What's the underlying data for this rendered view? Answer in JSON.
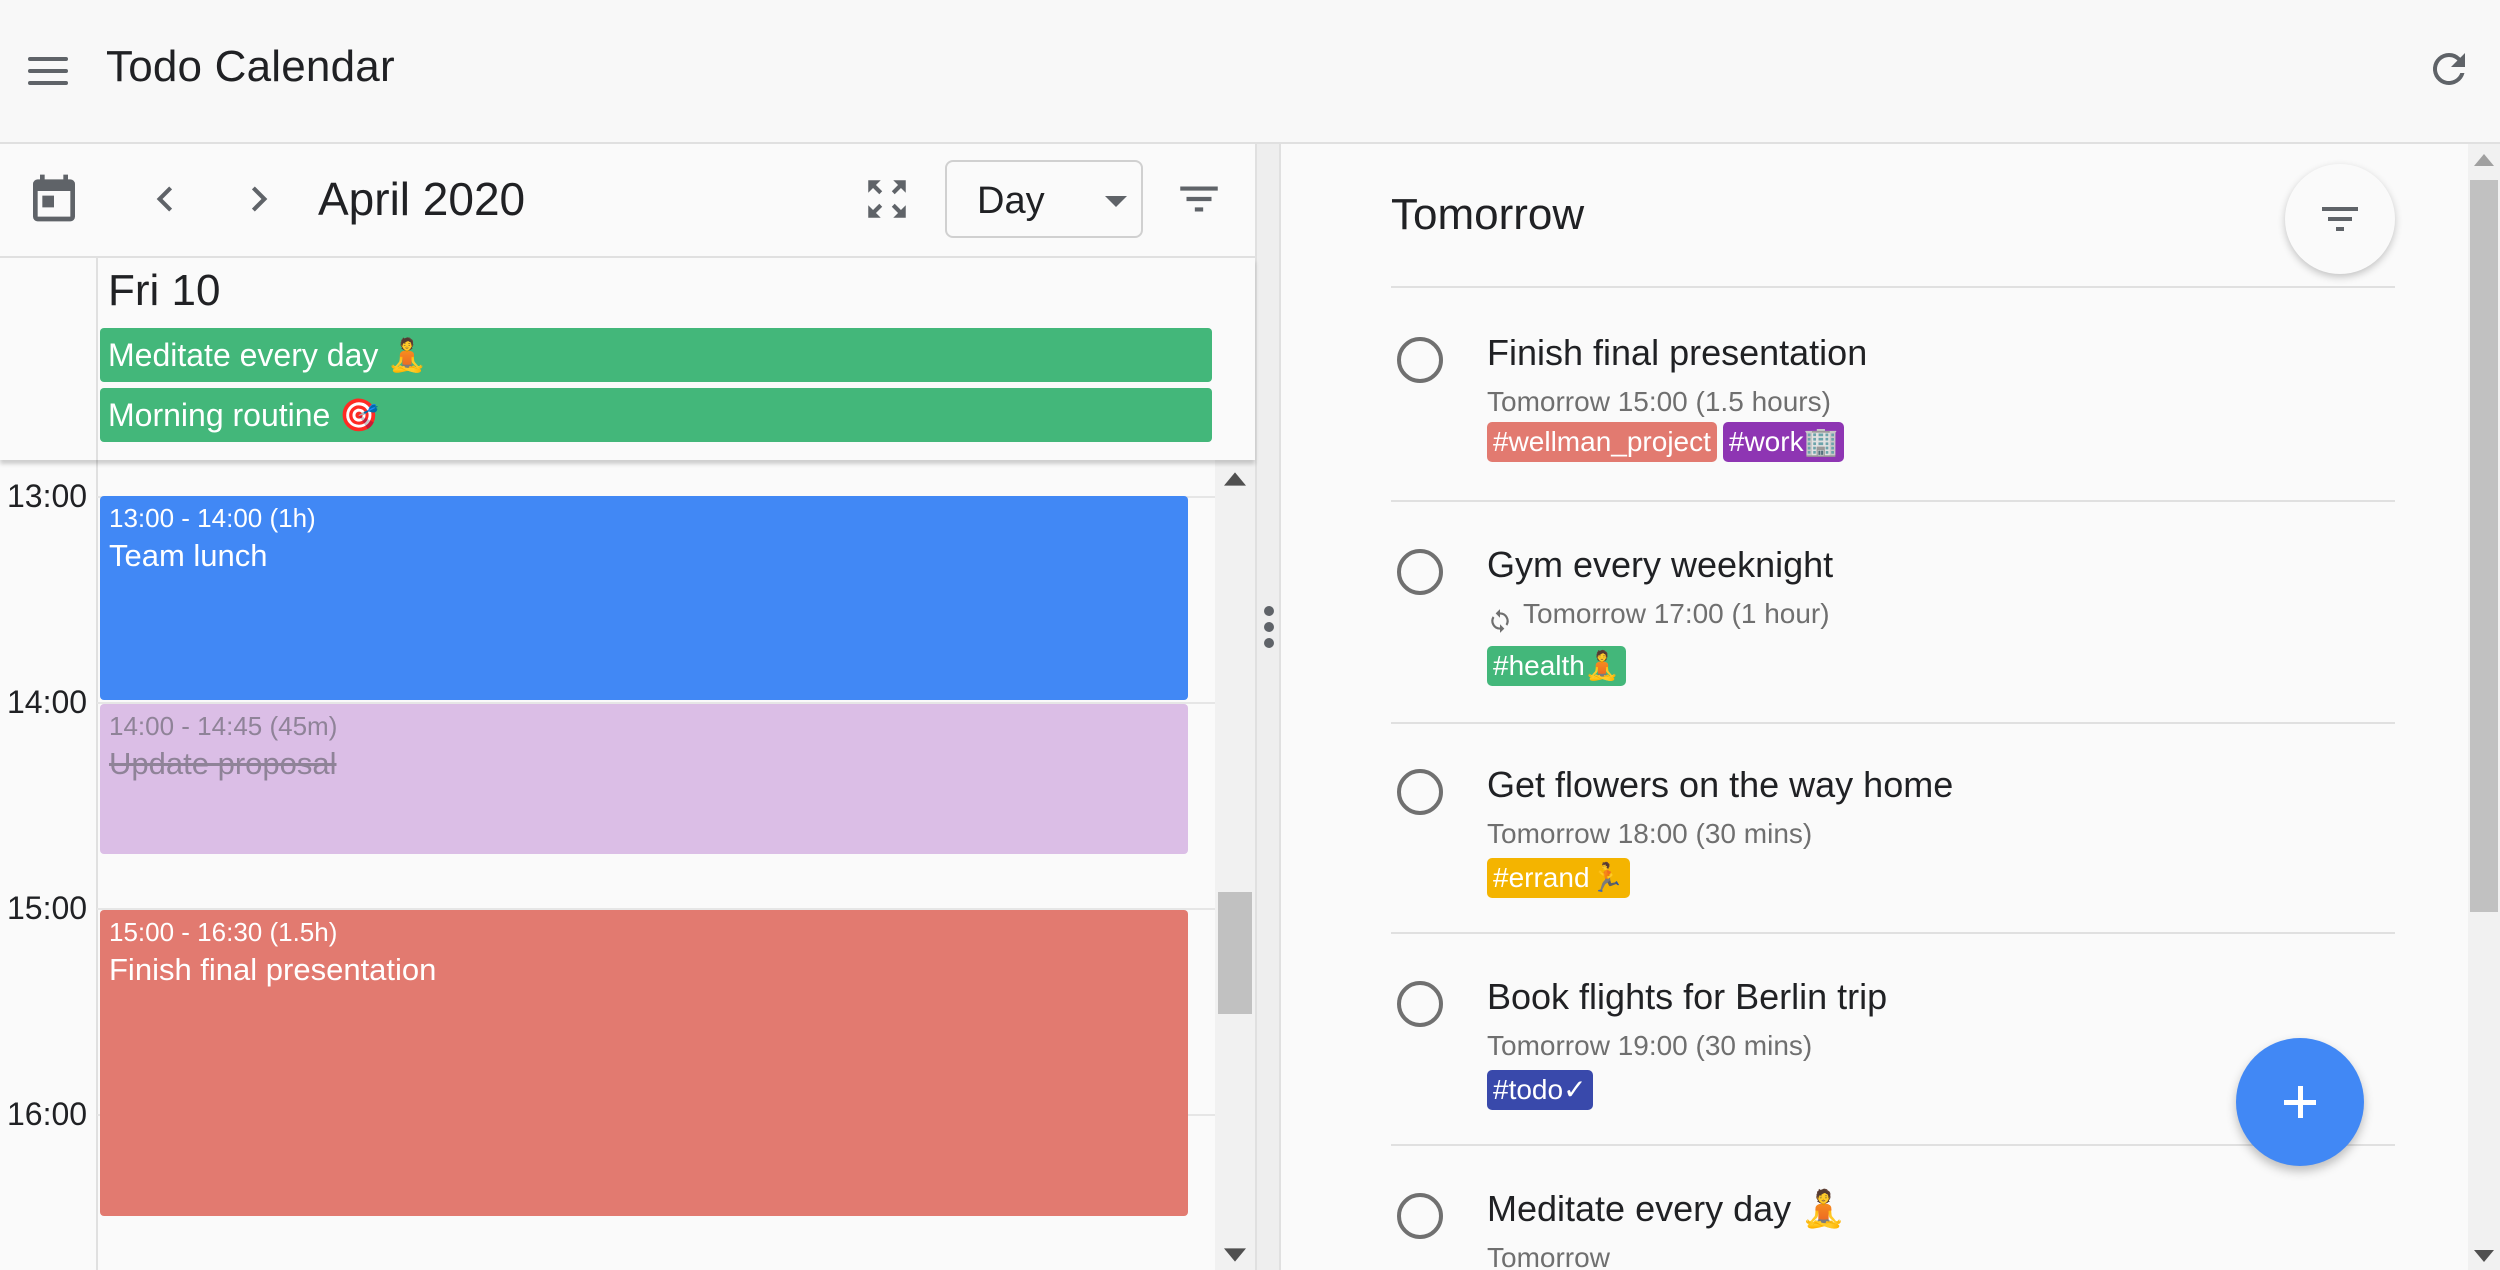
{
  "app": {
    "title": "Todo Calendar",
    "menu_icon": "hamburger-menu-icon",
    "refresh_icon": "refresh-icon"
  },
  "calendar": {
    "toolbar": {
      "calendar_icon": "calendar-icon",
      "prev_icon": "chevron-left-icon",
      "next_icon": "chevron-right-icon",
      "month_label": "April 2020",
      "fullscreen_icon": "fullscreen-icon",
      "view_select": {
        "value": "Day"
      },
      "filter_icon": "filter-icon"
    },
    "day_label": "Fri 10",
    "allday_events": [
      {
        "title": "Meditate every day",
        "emoji": "🧘",
        "color": "#43b77a"
      },
      {
        "title": "Morning routine",
        "emoji": "🎯",
        "color": "#43b77a"
      }
    ],
    "hours": [
      "13:00",
      "14:00",
      "15:00",
      "16:00"
    ],
    "events": [
      {
        "time": "13:00 - 14:00 (1h)",
        "title": "Team lunch",
        "color": "#4188f5"
      },
      {
        "time": "14:00 - 14:45 (45m)",
        "title": "Update proposal",
        "color": "#dbbee6",
        "completed": true
      },
      {
        "time": "15:00 - 16:30 (1.5h)",
        "title": "Finish final presentation",
        "color": "#e27a70"
      }
    ]
  },
  "todo": {
    "header": "Tomorrow",
    "filter_icon": "filter-icon",
    "items": [
      {
        "title": "Finish final presentation",
        "subtitle": "Tomorrow 15:00 (1.5 hours)",
        "recurring": false,
        "tags": [
          {
            "label": "#wellman_project",
            "color": "#e27a70"
          },
          {
            "label": "#work🏢",
            "color": "#8e35b3"
          }
        ]
      },
      {
        "title": "Gym every weeknight",
        "subtitle": "Tomorrow 17:00 (1 hour)",
        "recurring": true,
        "tags": [
          {
            "label": "#health🧘",
            "color": "#43b77a"
          }
        ]
      },
      {
        "title": "Get flowers on the way home",
        "subtitle": "Tomorrow 18:00 (30 mins)",
        "recurring": false,
        "tags": [
          {
            "label": "#errand🏃",
            "color": "#f4b400"
          }
        ]
      },
      {
        "title": "Book flights for Berlin trip",
        "subtitle": "Tomorrow 19:00 (30 mins)",
        "recurring": false,
        "tags": [
          {
            "label": "#todo✓",
            "color": "#3949ab"
          }
        ]
      },
      {
        "title": "Meditate every day 🧘",
        "subtitle": "Tomorrow",
        "recurring": false,
        "tags": []
      }
    ],
    "add_button_icon": "plus-icon"
  }
}
